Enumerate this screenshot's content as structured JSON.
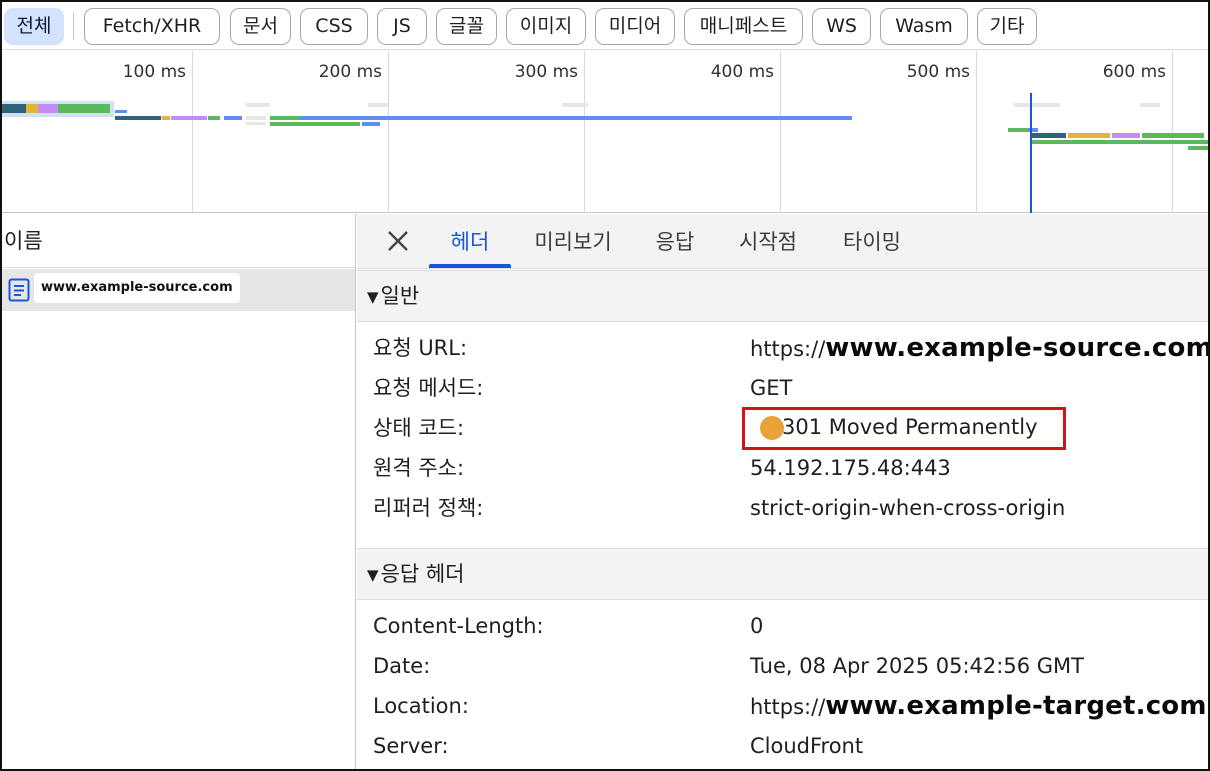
{
  "filters": [
    {
      "label": "전체",
      "active": true
    },
    {
      "label": "Fetch/XHR"
    },
    {
      "label": "문서"
    },
    {
      "label": "CSS"
    },
    {
      "label": "JS"
    },
    {
      "label": "글꼴"
    },
    {
      "label": "이미지"
    },
    {
      "label": "미디어"
    },
    {
      "label": "매니페스트"
    },
    {
      "label": "WS"
    },
    {
      "label": "Wasm"
    },
    {
      "label": "기타"
    }
  ],
  "overview": {
    "ticks": [
      "100 ms",
      "200 ms",
      "300 ms",
      "400 ms",
      "500 ms",
      "600 ms"
    ]
  },
  "colors": {
    "blue": "#5b8ff1",
    "green": "#5cb85c",
    "teal": "#2e6378",
    "orange": "#e3b43a",
    "purple": "#c48cf2",
    "grey": "#e6e6e6",
    "accent": "#1a56db",
    "highlight": "#d0141c"
  },
  "namePanel": {
    "header": "이름",
    "request": "www.example-source.com"
  },
  "tabs": {
    "items": [
      "헤더",
      "미리보기",
      "응답",
      "시작점",
      "타이밍"
    ],
    "active": "헤더"
  },
  "general": {
    "title": "일반",
    "requestUrlLabel": "요청 URL:",
    "requestUrlScheme": "https://",
    "requestUrlHost": "www.example-source.com",
    "methodLabel": "요청 메서드:",
    "method": "GET",
    "statusLabel": "상태 코드:",
    "status": "301 Moved Permanently",
    "remoteLabel": "원격 주소:",
    "remote": "54.192.175.48:443",
    "referrerLabel": "리퍼러 정책:",
    "referrer": "strict-origin-when-cross-origin"
  },
  "responseHeaders": {
    "title": "응답 헤더",
    "contentLengthLabel": "Content-Length:",
    "contentLength": "0",
    "dateLabel": "Date:",
    "date": "Tue, 08 Apr 2025 05:42:56 GMT",
    "locationLabel": "Location:",
    "locationScheme": "https://",
    "locationHost": "www.example-target.com",
    "serverLabel": "Server:",
    "server": "CloudFront"
  }
}
